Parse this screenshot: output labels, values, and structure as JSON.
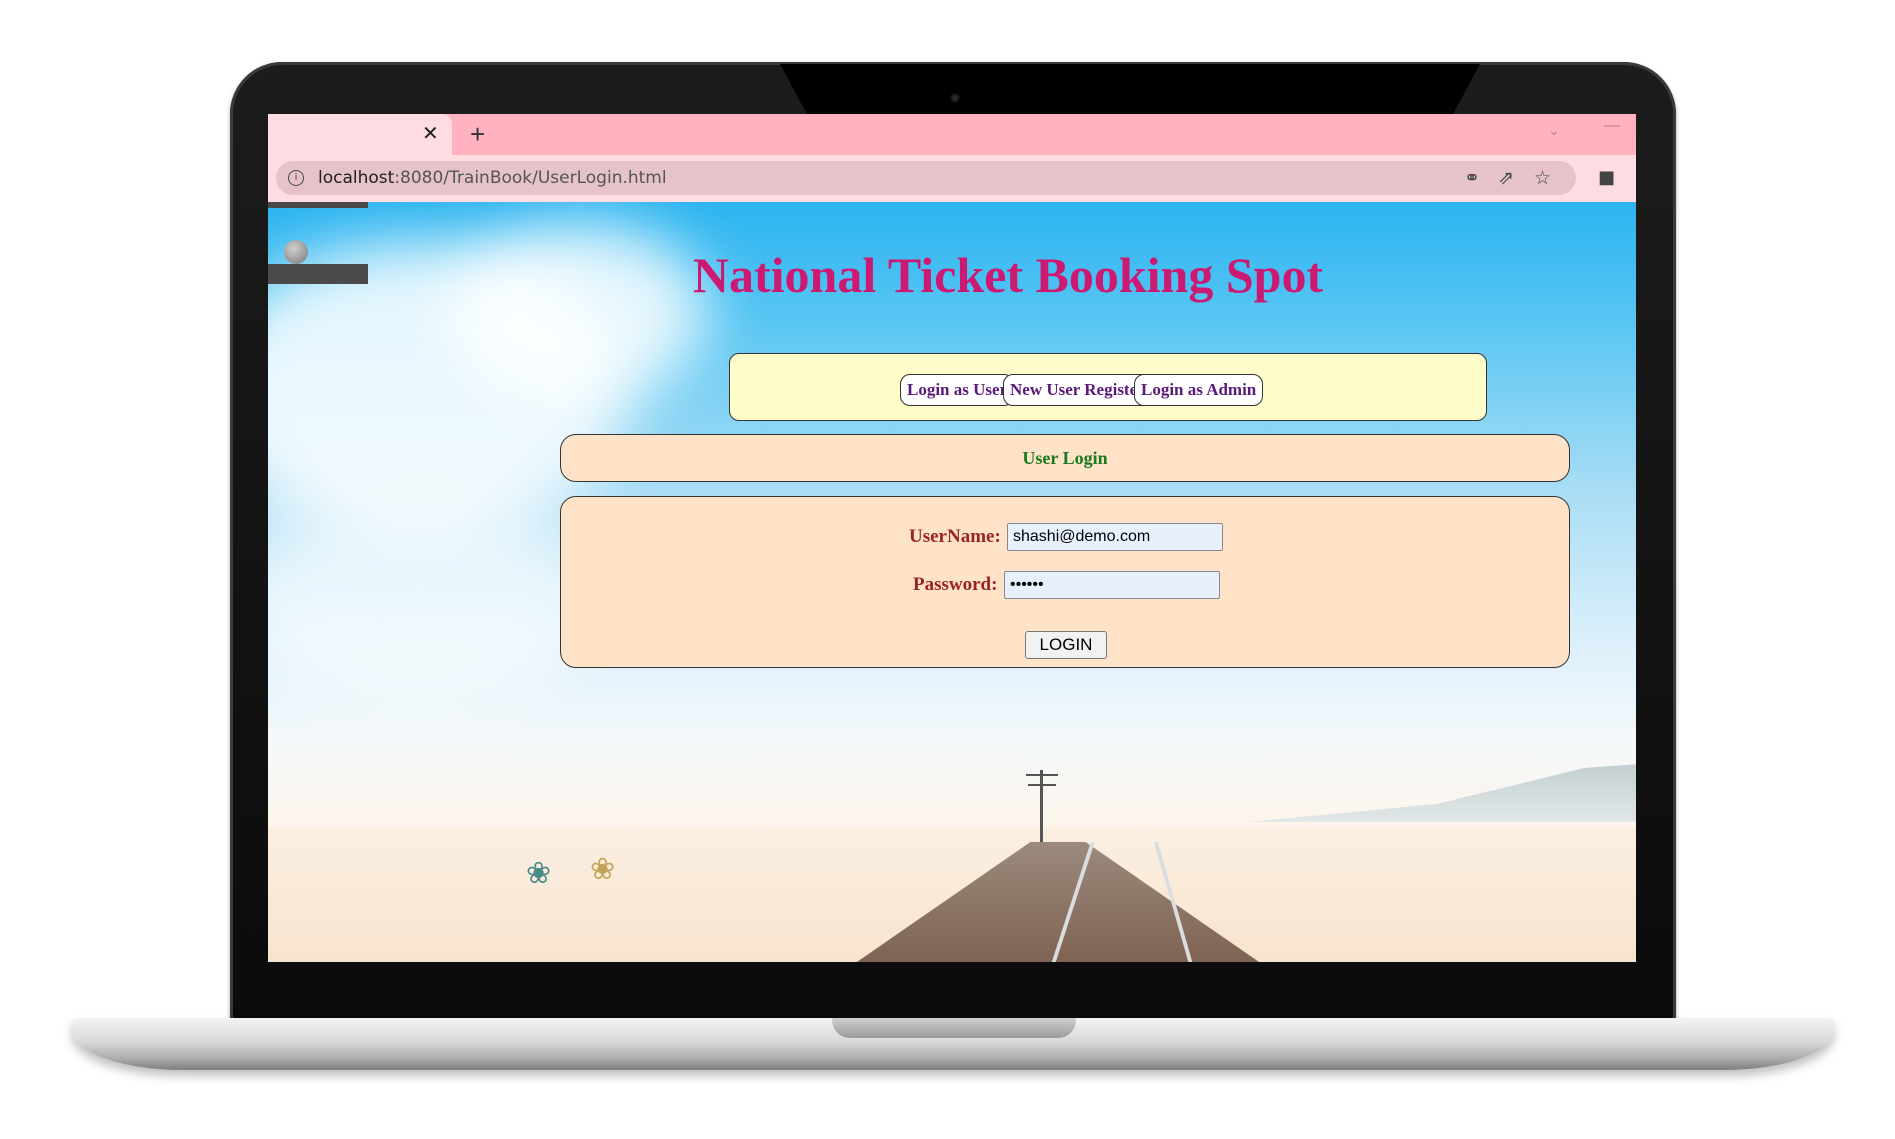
{
  "browser": {
    "tab_close": "✕",
    "new_tab": "+",
    "url_host": "localhost",
    "url_rest": ":8080/TrainBook/UserLogin.html",
    "icons": {
      "info": "info-icon",
      "key": "key-icon",
      "share": "share-icon",
      "star": "star-icon",
      "extensions": "puzzle-icon"
    }
  },
  "page": {
    "title": "National Ticket Booking Spot",
    "nav": {
      "login_user": "Login as User",
      "register": "New User Register",
      "login_admin": "Login as Admin"
    },
    "heading": "User Login",
    "form": {
      "username_label": "UserName:",
      "username_value": "shashi@demo.com",
      "password_label": "Password:",
      "password_value": "••••••",
      "login_button": "LOGIN"
    }
  },
  "colors": {
    "title": "#cc1a72",
    "nav_bg": "#fefcc8",
    "panel_bg": "#ffe3c8",
    "heading_text": "#1b7a1b",
    "label_text": "#9a2424",
    "tab_bar": "#ffb3c0"
  }
}
